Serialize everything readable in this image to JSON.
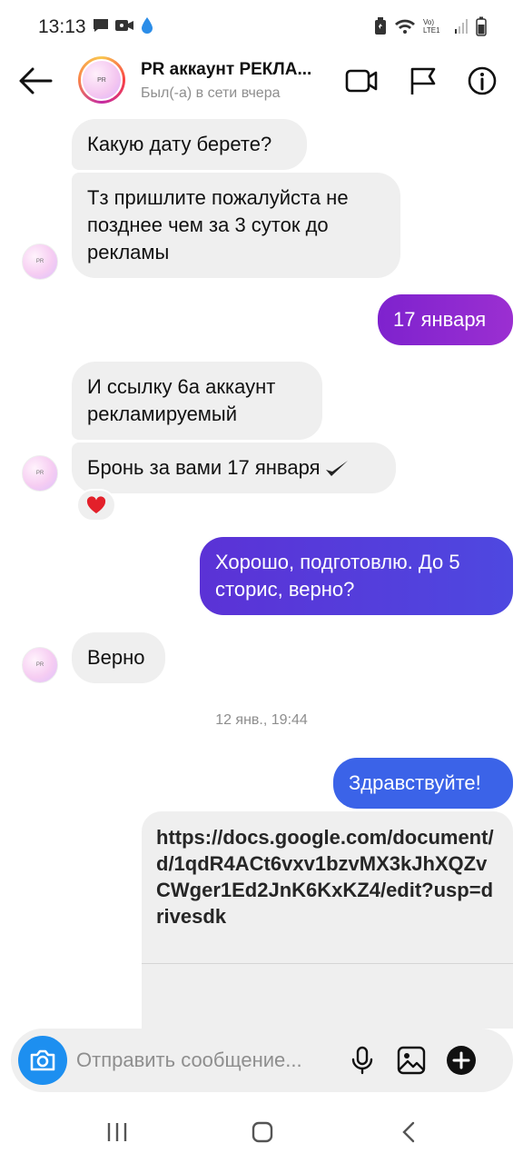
{
  "status_bar": {
    "time": "13:13",
    "network_label": "Vo) LTE1"
  },
  "header": {
    "title": "PR аккаунт РЕКЛА...",
    "subtitle": "Был(-а) в сети вчера",
    "avatar_text": "PR"
  },
  "messages": [
    {
      "side": "in",
      "text": "Какую дату берете?"
    },
    {
      "side": "in",
      "text": "Тз пришлите пожалуйста не позднее чем за 3 суток до рекламы"
    },
    {
      "side": "out",
      "text": "17 января"
    },
    {
      "side": "in",
      "text": "И ссылку 6а аккаунт рекламируемый"
    },
    {
      "side": "in",
      "text": "Бронь за вами 17 января"
    },
    {
      "side": "out",
      "text": "Хорошо, подготовлю. До 5 сторис, верно?"
    },
    {
      "side": "in",
      "text": "Верно"
    },
    {
      "side": "out",
      "text": "Здравствуйте!"
    },
    {
      "side": "out",
      "text": "https://docs.google.com/document/d/1qdR4ACt6vxv1bzvMX3kJhXQZvCWger1Ed2JnK6KxKZ4/edit?usp=drivesdk"
    }
  ],
  "reaction": "heart",
  "timestamp": "12 янв., 19:44",
  "composer": {
    "placeholder": "Отправить сообщение..."
  },
  "colors": {
    "bubble_in": "#efefef",
    "bubble_out_purple": "#8a2be2",
    "bubble_out_indigo": "#5b3fd9",
    "bubble_out_blue": "#3b63e8",
    "camera_button": "#1d8ff0"
  },
  "icons": [
    "back-arrow-icon",
    "video-call-icon",
    "flag-icon",
    "info-icon",
    "camera-icon",
    "microphone-icon",
    "gallery-icon",
    "plus-icon",
    "heart-icon",
    "checkmark-icon"
  ]
}
